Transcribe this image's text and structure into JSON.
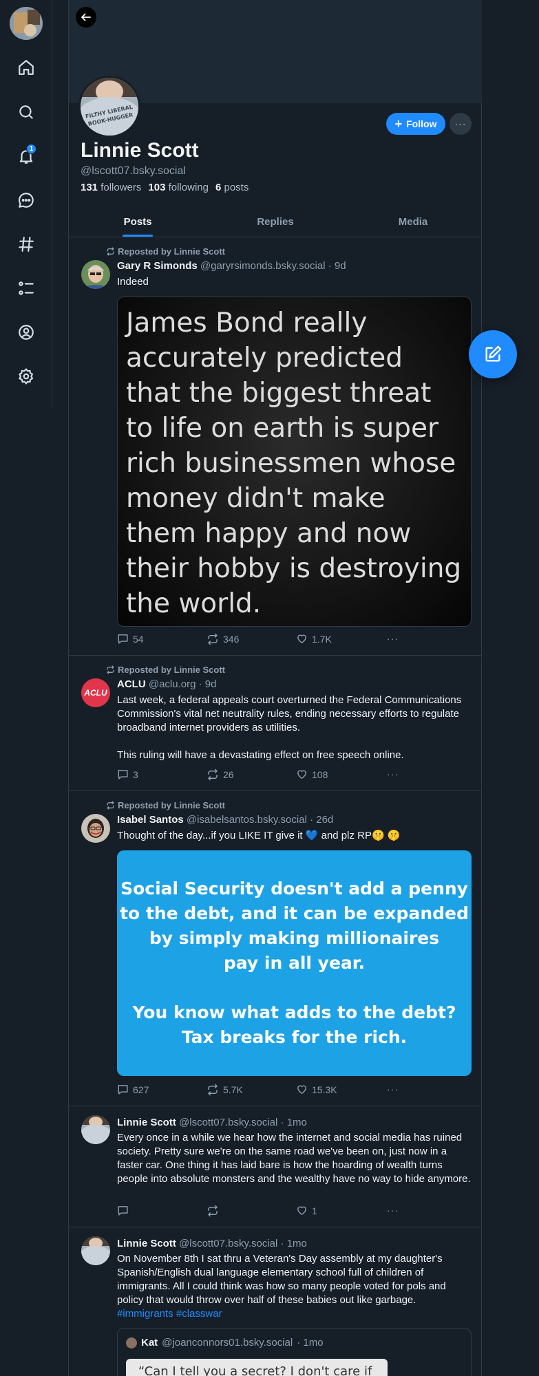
{
  "nav": {
    "items": [
      {
        "name": "home-icon"
      },
      {
        "name": "search-icon"
      },
      {
        "name": "notifications-icon",
        "badge": "1"
      },
      {
        "name": "chat-icon"
      },
      {
        "name": "feeds-hash-icon"
      },
      {
        "name": "lists-icon"
      },
      {
        "name": "profile-icon"
      },
      {
        "name": "settings-icon"
      }
    ]
  },
  "profile": {
    "display_name": "Linnie Scott",
    "handle": "@lscott07.bsky.social",
    "followers_count": "131",
    "followers_label": "followers",
    "following_count": "103",
    "following_label": "following",
    "posts_count": "6",
    "posts_label": "posts",
    "follow_label": "Follow",
    "avatar_text": "FILTHY LIBERAL BOOK-HUGGER"
  },
  "tabs": [
    {
      "label": "Posts",
      "active": true
    },
    {
      "label": "Replies",
      "active": false
    },
    {
      "label": "Media",
      "active": false
    }
  ],
  "posts": [
    {
      "repost_by": "Reposted by Linnie Scott",
      "author": "Gary R Simonds",
      "handle": "@garyrsimonds.bsky.social",
      "time": "· 9d",
      "text": "Indeed",
      "image_text": "James Bond really accurately predicted that the biggest threat to life on earth is super rich businessmen whose money didn't make them happy and now their hobby is destroying the world.",
      "replies": "54",
      "reposts": "346",
      "likes": "1.7K"
    },
    {
      "repost_by": "Reposted by Linnie Scott",
      "author": "ACLU",
      "handle": "@aclu.org",
      "time": "· 9d",
      "avatar_text": "ACLU",
      "text": "Last week, a federal appeals court overturned the Federal Communications Commission's vital net neutrality rules, ending necessary efforts to regulate broadband internet providers as utilities.",
      "text2": "This ruling will have a devastating effect on free speech online.",
      "replies": "3",
      "reposts": "26",
      "likes": "108"
    },
    {
      "repost_by": "Reposted by Linnie Scott",
      "author": "Isabel Santos",
      "handle": "@isabelsantos.bsky.social",
      "time": "· 26d",
      "text": "Thought of the day...if you LIKE IT give it 💙 and plz RP🤫 🤫",
      "image_line1": "Social Security doesn't add a penny",
      "image_line2": "to the debt, and it can be expanded",
      "image_line3": "by simply making millionaires",
      "image_line4": "pay in all year.",
      "image_line5": "You know what adds to the debt?",
      "image_line6": "Tax breaks for the rich.",
      "replies": "627",
      "reposts": "5.7K",
      "likes": "15.3K"
    },
    {
      "author": "Linnie Scott",
      "handle": "@lscott07.bsky.social",
      "time": "· 1mo",
      "text": "Every once in a while we hear how the internet and social media has ruined society. Pretty sure we're on the same road we've been on, just now in a faster car. One thing it has laid bare is how the hoarding of wealth turns people into absolute monsters and the wealthy have no way to hide anymore.",
      "replies": "",
      "reposts": "",
      "likes": "1"
    },
    {
      "author": "Linnie Scott",
      "handle": "@lscott07.bsky.social",
      "time": "· 1mo",
      "text": "On November 8th I sat thru a Veteran's Day assembly at my daughter's Spanish/English dual language elementary school full of children of immigrants. All I could think was how so many people voted for pols and policy that would throw over half of these babies out like garbage.",
      "tag1": "#immigrants",
      "tag2": "#classwar",
      "quote_author": "Kat",
      "quote_handle": "@joanconnors01.bsky.social",
      "quote_time": "· 1mo",
      "quote_text": "“Can I tell you a secret? I don't care if"
    }
  ]
}
